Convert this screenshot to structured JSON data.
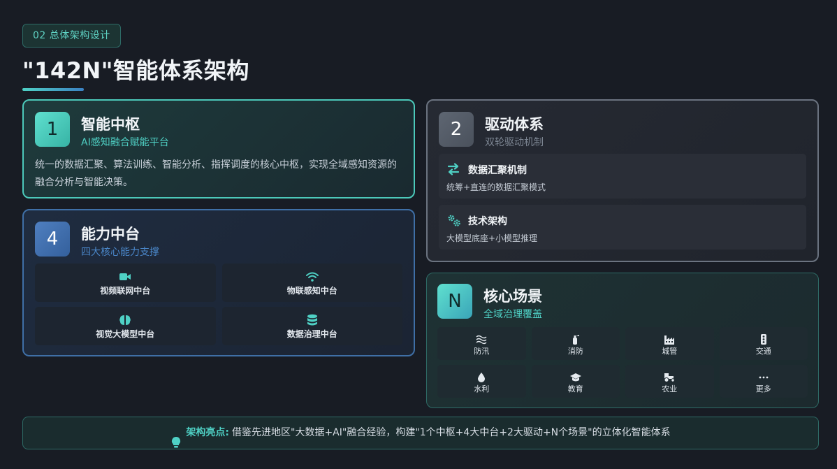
{
  "header": {
    "section_tag": "02  总体架构设计",
    "title": "\"142N\"智能体系架构"
  },
  "colors": {
    "accent_teal": "#4fd1c5",
    "accent_blue": "#3f6fa6",
    "background": "#181c24"
  },
  "cards": {
    "hub": {
      "number": "1",
      "title": "智能中枢",
      "subtitle": "AI感知融合赋能平台",
      "description": "统一的数据汇聚、算法训练、智能分析、指挥调度的核心中枢，实现全域感知资源的融合分析与智能决策。"
    },
    "capability": {
      "number": "4",
      "title": "能力中台",
      "subtitle": "四大核心能力支撑",
      "items": [
        {
          "icon": "video-camera-icon",
          "label": "视频联网中台"
        },
        {
          "icon": "wifi-icon",
          "label": "物联感知中台"
        },
        {
          "icon": "brain-icon",
          "label": "视觉大模型中台"
        },
        {
          "icon": "database-icon",
          "label": "数据治理中台"
        }
      ]
    },
    "driver": {
      "number": "2",
      "title": "驱动体系",
      "subtitle": "双轮驱动机制",
      "items": [
        {
          "icon": "exchange-arrows-icon",
          "title": "数据汇聚机制",
          "desc": "统筹+直连的数据汇聚模式"
        },
        {
          "icon": "cogs-icon",
          "title": "技术架构",
          "desc": "大模型底座+小模型推理"
        }
      ]
    },
    "scenes": {
      "number": "N",
      "title": "核心场景",
      "subtitle": "全域治理覆盖",
      "items": [
        {
          "icon": "water-waves-icon",
          "label": "防汛"
        },
        {
          "icon": "fire-extinguisher-icon",
          "label": "消防"
        },
        {
          "icon": "industry-icon",
          "label": "城管"
        },
        {
          "icon": "traffic-light-icon",
          "label": "交通"
        },
        {
          "icon": "water-drop-icon",
          "label": "水利"
        },
        {
          "icon": "graduation-cap-icon",
          "label": "教育"
        },
        {
          "icon": "tractor-icon",
          "label": "农业"
        },
        {
          "icon": "ellipsis-icon",
          "label": "更多"
        }
      ]
    }
  },
  "highlight": {
    "icon": "lightbulb-icon",
    "label": "架构亮点:",
    "text": "借鉴先进地区\"大数据+AI\"融合经验，构建\"1个中枢+4大中台+2大驱动+N个场景\"的立体化智能体系"
  }
}
